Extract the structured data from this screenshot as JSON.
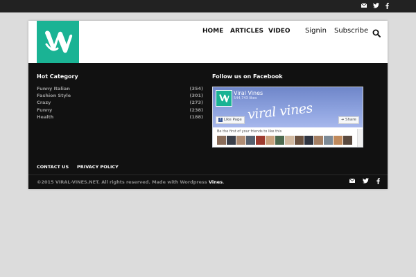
{
  "topbar": {
    "icons": [
      "envelope-icon",
      "twitter-icon",
      "facebook-icon"
    ]
  },
  "header": {
    "logo": "viral-vines-logo",
    "nav": [
      "HOME",
      "ARTICLES",
      "VIDEO"
    ],
    "signin_label": "Signin",
    "subscribe_label": "Subscribe",
    "search_icon": "search-icon"
  },
  "footer": {
    "hot_category": {
      "title": "Hot Category",
      "items": [
        {
          "name": "Funny Italian",
          "count": "(354)"
        },
        {
          "name": "Fashion Style",
          "count": "(301)"
        },
        {
          "name": "Crazy",
          "count": "(273)"
        },
        {
          "name": "Funny",
          "count": "(238)"
        },
        {
          "name": "Health",
          "count": "(188)"
        }
      ]
    },
    "facebook": {
      "title": "Follow us on Facebook",
      "page_name": "Viral Vines",
      "likes": "544,743 likes",
      "cover_text": "viral vines",
      "like_button": "Like Page",
      "share_button": "Share",
      "first_friends": "Be the first of your friends to like this"
    },
    "links": [
      "CONTACT US",
      "PRIVACY POLICY"
    ],
    "copyright_prefix": "©2015 VIRAL-VINES.NET. All rights reserved. Made with Wordpress",
    "copyright_brand": "Vines",
    "copyright_suffix": ".",
    "social_icons": [
      "envelope-icon",
      "twitter-icon",
      "facebook-icon"
    ]
  },
  "colors": {
    "brand": "#1ab394",
    "topbar": "#222222",
    "footer": "#111111",
    "page": "#dcdcdc"
  }
}
